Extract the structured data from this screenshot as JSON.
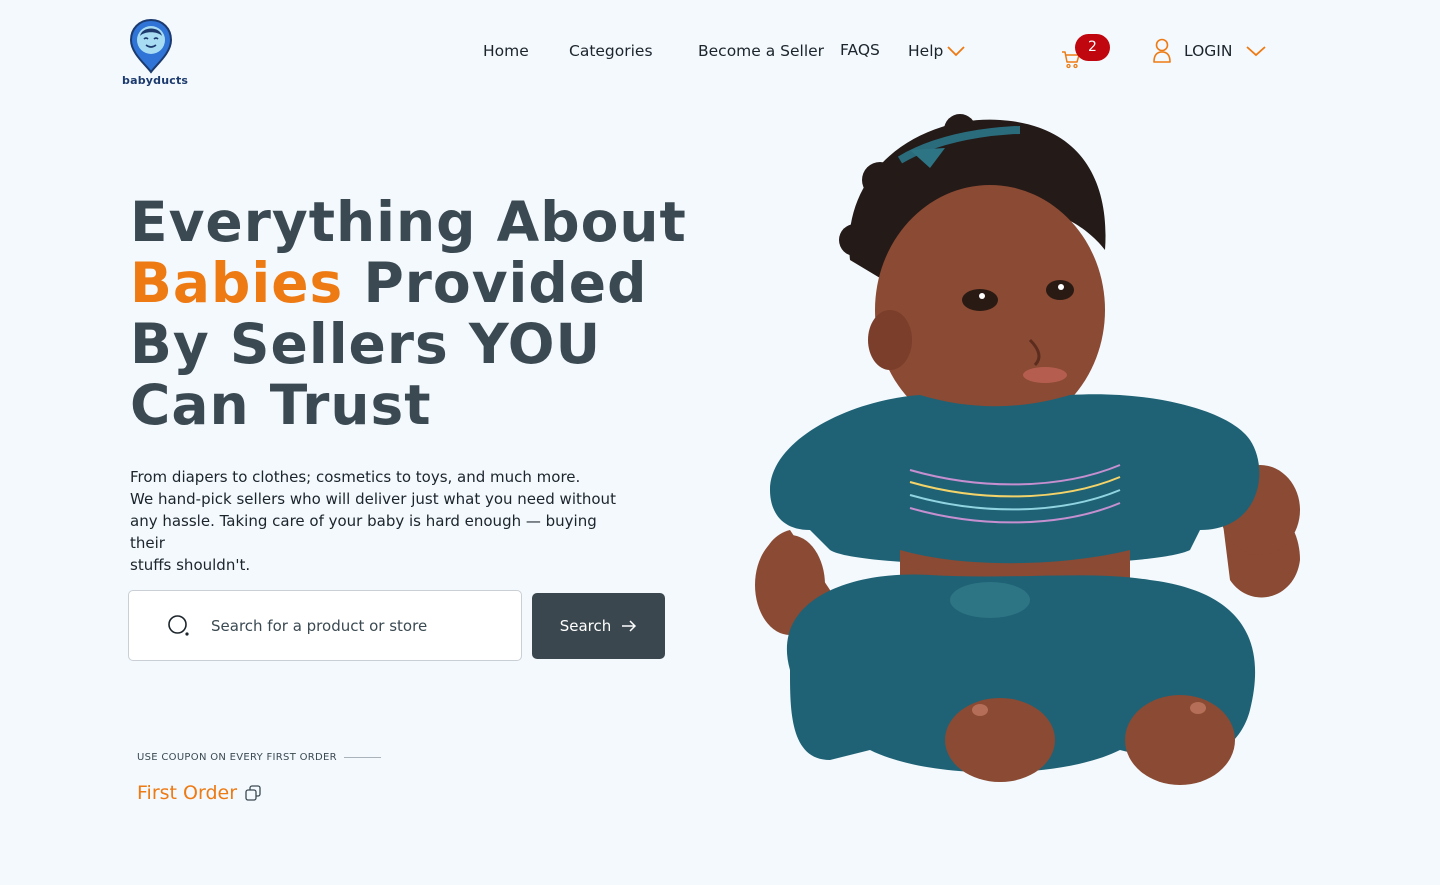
{
  "brand": {
    "name": "babyducts",
    "color": "#1c3a6e"
  },
  "nav": {
    "home": "Home",
    "categories": "Categories",
    "become_seller": "Become a Seller",
    "faqs": "FAQS",
    "help": "Help"
  },
  "cart": {
    "count": "2",
    "badge_color": "#c0070f"
  },
  "account": {
    "login_label": "LOGIN"
  },
  "hero": {
    "headline": {
      "part1": "Everything About",
      "accent": "Babies",
      "part2": "Provided",
      "part3": "By Sellers YOU",
      "part4": "Can Trust"
    },
    "description": {
      "line1": "From diapers to clothes; cosmetics to toys, and much more.",
      "line2": "We hand-pick sellers who will deliver just what you need without",
      "line3": "any hassle. Taking care of your baby is hard enough — buying their",
      "line4": "stuffs shouldn't."
    }
  },
  "search": {
    "placeholder": "Search for a product or store",
    "value": "",
    "button_label": "Search"
  },
  "coupon": {
    "label": "USE COUPON ON EVERY FIRST ORDER",
    "code": "First Order"
  },
  "colors": {
    "accent": "#ee7a13",
    "heading": "#3b4a52",
    "button": "#3a474e",
    "background": "#f3f9fd"
  },
  "icons": {
    "logo": "baby-face-pin-icon",
    "help_chevron": "chevron-down-icon",
    "cart": "shopping-cart-icon",
    "user": "user-icon",
    "login_chevron": "chevron-down-icon",
    "search": "search-icon",
    "search_arrow": "arrow-right-icon",
    "copy": "copy-icon"
  }
}
